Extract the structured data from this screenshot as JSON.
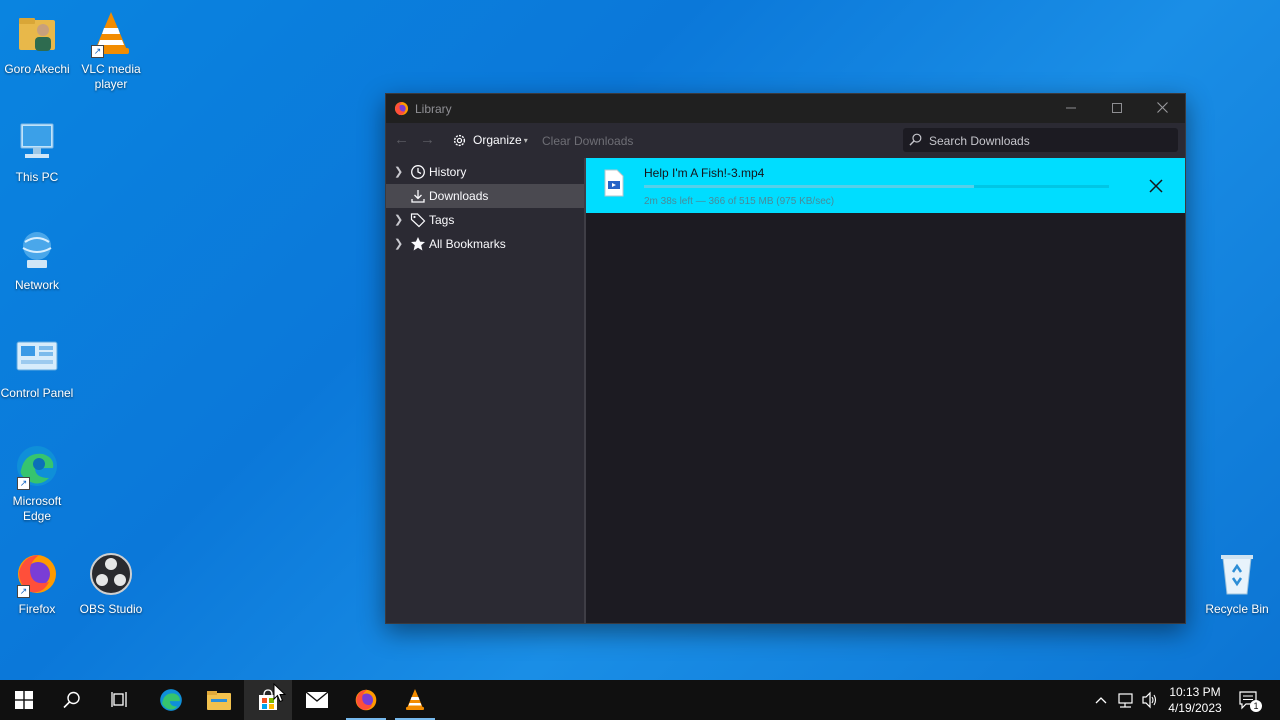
{
  "desktop": {
    "icons": [
      {
        "label": "Goro Akechi",
        "icon": "user-folder-icon"
      },
      {
        "label": "VLC media player",
        "icon": "vlc-icon"
      },
      {
        "label": "This PC",
        "icon": "computer-icon"
      },
      {
        "label": "Network",
        "icon": "network-icon"
      },
      {
        "label": "Control Panel",
        "icon": "control-panel-icon"
      },
      {
        "label": "Microsoft Edge",
        "icon": "edge-icon"
      },
      {
        "label": "Firefox",
        "icon": "firefox-icon"
      },
      {
        "label": "OBS Studio",
        "icon": "obs-icon"
      },
      {
        "label": "Recycle Bin",
        "icon": "recycle-bin-icon"
      }
    ]
  },
  "window": {
    "title": "Library",
    "toolbar": {
      "organize_label": "Organize",
      "clear_label": "Clear Downloads",
      "search_placeholder": "Search Downloads"
    },
    "sidebar": {
      "items": [
        {
          "label": "History",
          "icon": "clock-icon"
        },
        {
          "label": "Downloads",
          "icon": "download-icon"
        },
        {
          "label": "Tags",
          "icon": "tag-icon"
        },
        {
          "label": "All Bookmarks",
          "icon": "star-icon"
        }
      ]
    },
    "downloads": [
      {
        "filename": "Help I'm A Fish!-3.mp4",
        "status": "2m 38s left — 366 of 515 MB (975 KB/sec)",
        "progress": 0.71
      }
    ]
  },
  "taskbar": {
    "time": "10:13 PM",
    "date": "4/19/2023",
    "notification_count": "1"
  },
  "colors": {
    "desktop_bg": "#0b78d9",
    "download_highlight": "#00ddff",
    "window_bg": "#1c1b22",
    "sidebar_bg": "#2b2a33"
  }
}
